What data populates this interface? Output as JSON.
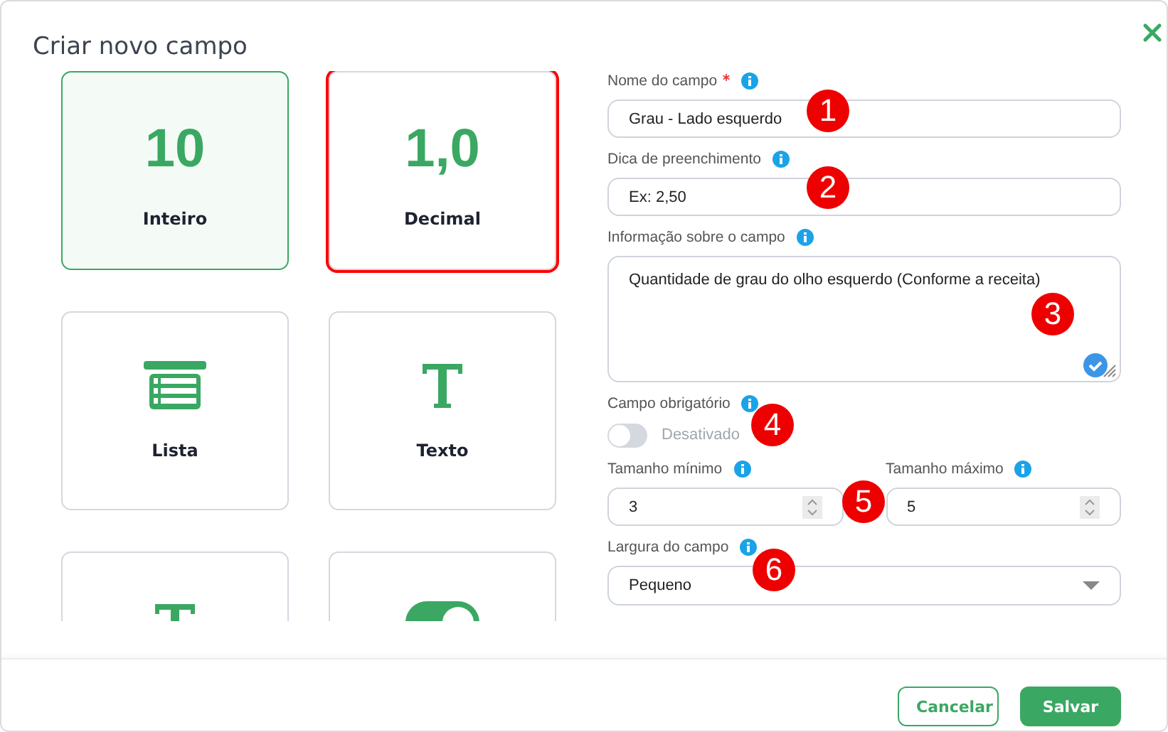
{
  "dialog": {
    "title": "Criar novo campo"
  },
  "cards": [
    {
      "kind": "number",
      "symbol": "10",
      "label": "Inteiro",
      "selected": true,
      "highlighted": false
    },
    {
      "kind": "number",
      "symbol": "1,0",
      "label": "Decimal",
      "selected": false,
      "highlighted": true
    },
    {
      "kind": "list",
      "label": "Lista",
      "selected": false,
      "highlighted": false
    },
    {
      "kind": "text",
      "label": "Texto",
      "selected": false,
      "highlighted": false
    },
    {
      "kind": "text",
      "selected": false,
      "highlighted": false
    },
    {
      "kind": "toggle",
      "selected": false,
      "highlighted": false
    }
  ],
  "fields": [
    {
      "kind": "text",
      "label": "Nome do campo",
      "required": true,
      "value": "Grau - Lado esquerdo",
      "marker": "1"
    },
    {
      "kind": "text",
      "label": "Dica de preenchimento",
      "required": false,
      "value": "Ex: 2,50",
      "marker": "2"
    },
    {
      "kind": "textarea",
      "label": "Informação sobre o campo",
      "required": false,
      "value": "Quantidade de grau do olho esquerdo (Conforme a receita)",
      "marker": "3"
    },
    {
      "kind": "toggle",
      "label": "Campo obrigatório",
      "required": false,
      "on": false,
      "state_text": "Desativado",
      "marker": "4"
    },
    {
      "kind": "pair",
      "marker": "5",
      "items": [
        {
          "label": "Tamanho mínimo",
          "value": "3"
        },
        {
          "label": "Tamanho máximo",
          "value": "5"
        }
      ]
    },
    {
      "kind": "select",
      "label": "Largura do campo",
      "required": false,
      "value": "Pequeno",
      "marker": "6"
    }
  ],
  "buttons": [
    {
      "kind": "secondary",
      "label": "Cancelar"
    },
    {
      "kind": "primary",
      "label": "Salvar"
    }
  ]
}
